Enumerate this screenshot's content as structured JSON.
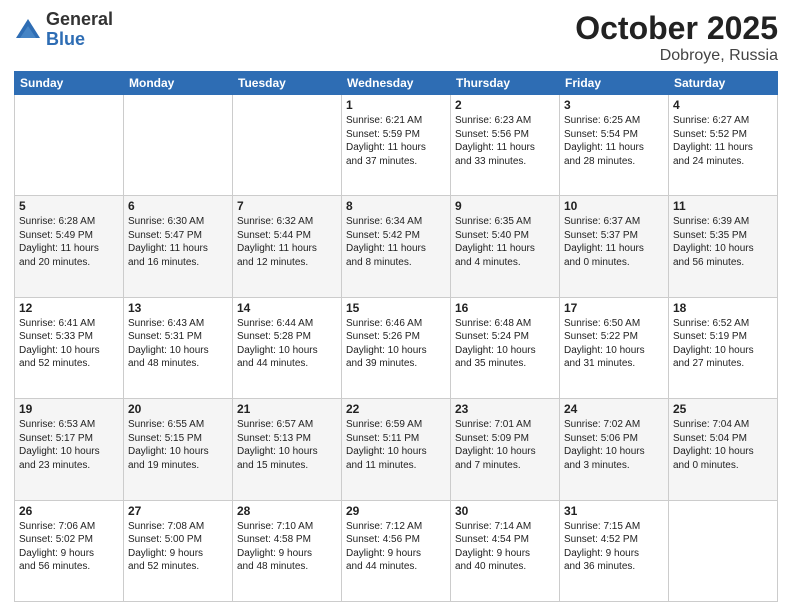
{
  "logo": {
    "general": "General",
    "blue": "Blue"
  },
  "header": {
    "month": "October 2025",
    "location": "Dobroye, Russia"
  },
  "weekdays": [
    "Sunday",
    "Monday",
    "Tuesday",
    "Wednesday",
    "Thursday",
    "Friday",
    "Saturday"
  ],
  "weeks": [
    [
      {
        "day": "",
        "info": ""
      },
      {
        "day": "",
        "info": ""
      },
      {
        "day": "",
        "info": ""
      },
      {
        "day": "1",
        "info": "Sunrise: 6:21 AM\nSunset: 5:59 PM\nDaylight: 11 hours\nand 37 minutes."
      },
      {
        "day": "2",
        "info": "Sunrise: 6:23 AM\nSunset: 5:56 PM\nDaylight: 11 hours\nand 33 minutes."
      },
      {
        "day": "3",
        "info": "Sunrise: 6:25 AM\nSunset: 5:54 PM\nDaylight: 11 hours\nand 28 minutes."
      },
      {
        "day": "4",
        "info": "Sunrise: 6:27 AM\nSunset: 5:52 PM\nDaylight: 11 hours\nand 24 minutes."
      }
    ],
    [
      {
        "day": "5",
        "info": "Sunrise: 6:28 AM\nSunset: 5:49 PM\nDaylight: 11 hours\nand 20 minutes."
      },
      {
        "day": "6",
        "info": "Sunrise: 6:30 AM\nSunset: 5:47 PM\nDaylight: 11 hours\nand 16 minutes."
      },
      {
        "day": "7",
        "info": "Sunrise: 6:32 AM\nSunset: 5:44 PM\nDaylight: 11 hours\nand 12 minutes."
      },
      {
        "day": "8",
        "info": "Sunrise: 6:34 AM\nSunset: 5:42 PM\nDaylight: 11 hours\nand 8 minutes."
      },
      {
        "day": "9",
        "info": "Sunrise: 6:35 AM\nSunset: 5:40 PM\nDaylight: 11 hours\nand 4 minutes."
      },
      {
        "day": "10",
        "info": "Sunrise: 6:37 AM\nSunset: 5:37 PM\nDaylight: 11 hours\nand 0 minutes."
      },
      {
        "day": "11",
        "info": "Sunrise: 6:39 AM\nSunset: 5:35 PM\nDaylight: 10 hours\nand 56 minutes."
      }
    ],
    [
      {
        "day": "12",
        "info": "Sunrise: 6:41 AM\nSunset: 5:33 PM\nDaylight: 10 hours\nand 52 minutes."
      },
      {
        "day": "13",
        "info": "Sunrise: 6:43 AM\nSunset: 5:31 PM\nDaylight: 10 hours\nand 48 minutes."
      },
      {
        "day": "14",
        "info": "Sunrise: 6:44 AM\nSunset: 5:28 PM\nDaylight: 10 hours\nand 44 minutes."
      },
      {
        "day": "15",
        "info": "Sunrise: 6:46 AM\nSunset: 5:26 PM\nDaylight: 10 hours\nand 39 minutes."
      },
      {
        "day": "16",
        "info": "Sunrise: 6:48 AM\nSunset: 5:24 PM\nDaylight: 10 hours\nand 35 minutes."
      },
      {
        "day": "17",
        "info": "Sunrise: 6:50 AM\nSunset: 5:22 PM\nDaylight: 10 hours\nand 31 minutes."
      },
      {
        "day": "18",
        "info": "Sunrise: 6:52 AM\nSunset: 5:19 PM\nDaylight: 10 hours\nand 27 minutes."
      }
    ],
    [
      {
        "day": "19",
        "info": "Sunrise: 6:53 AM\nSunset: 5:17 PM\nDaylight: 10 hours\nand 23 minutes."
      },
      {
        "day": "20",
        "info": "Sunrise: 6:55 AM\nSunset: 5:15 PM\nDaylight: 10 hours\nand 19 minutes."
      },
      {
        "day": "21",
        "info": "Sunrise: 6:57 AM\nSunset: 5:13 PM\nDaylight: 10 hours\nand 15 minutes."
      },
      {
        "day": "22",
        "info": "Sunrise: 6:59 AM\nSunset: 5:11 PM\nDaylight: 10 hours\nand 11 minutes."
      },
      {
        "day": "23",
        "info": "Sunrise: 7:01 AM\nSunset: 5:09 PM\nDaylight: 10 hours\nand 7 minutes."
      },
      {
        "day": "24",
        "info": "Sunrise: 7:02 AM\nSunset: 5:06 PM\nDaylight: 10 hours\nand 3 minutes."
      },
      {
        "day": "25",
        "info": "Sunrise: 7:04 AM\nSunset: 5:04 PM\nDaylight: 10 hours\nand 0 minutes."
      }
    ],
    [
      {
        "day": "26",
        "info": "Sunrise: 7:06 AM\nSunset: 5:02 PM\nDaylight: 9 hours\nand 56 minutes."
      },
      {
        "day": "27",
        "info": "Sunrise: 7:08 AM\nSunset: 5:00 PM\nDaylight: 9 hours\nand 52 minutes."
      },
      {
        "day": "28",
        "info": "Sunrise: 7:10 AM\nSunset: 4:58 PM\nDaylight: 9 hours\nand 48 minutes."
      },
      {
        "day": "29",
        "info": "Sunrise: 7:12 AM\nSunset: 4:56 PM\nDaylight: 9 hours\nand 44 minutes."
      },
      {
        "day": "30",
        "info": "Sunrise: 7:14 AM\nSunset: 4:54 PM\nDaylight: 9 hours\nand 40 minutes."
      },
      {
        "day": "31",
        "info": "Sunrise: 7:15 AM\nSunset: 4:52 PM\nDaylight: 9 hours\nand 36 minutes."
      },
      {
        "day": "",
        "info": ""
      }
    ]
  ]
}
